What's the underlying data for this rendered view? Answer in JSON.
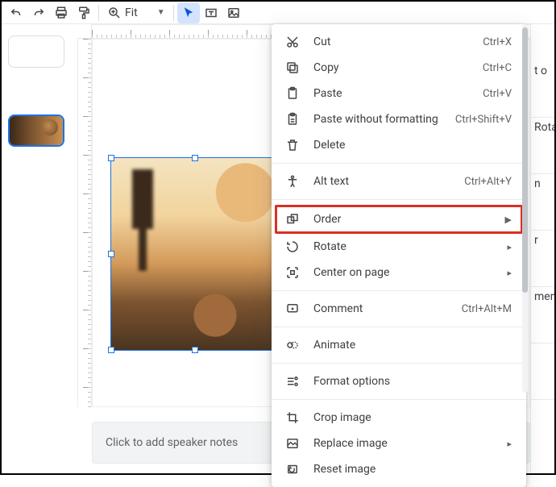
{
  "toolbar": {
    "zoom_label": "Fit"
  },
  "notes": {
    "placeholder": "Click to add speaker notes"
  },
  "side": {
    "f1": "t o",
    "f2": "Rota",
    "f3": "n",
    "f4": "r",
    "f5": "men"
  },
  "menu": {
    "cut": {
      "label": "Cut",
      "shortcut": "Ctrl+X"
    },
    "copy": {
      "label": "Copy",
      "shortcut": "Ctrl+C"
    },
    "paste": {
      "label": "Paste",
      "shortcut": "Ctrl+V"
    },
    "paste_wf": {
      "label": "Paste without formatting",
      "shortcut": "Ctrl+Shift+V"
    },
    "delete": {
      "label": "Delete"
    },
    "alt_text": {
      "label": "Alt text",
      "shortcut": "Ctrl+Alt+Y"
    },
    "order": {
      "label": "Order"
    },
    "rotate": {
      "label": "Rotate"
    },
    "center": {
      "label": "Center on page"
    },
    "comment": {
      "label": "Comment",
      "shortcut": "Ctrl+Alt+M"
    },
    "animate": {
      "label": "Animate"
    },
    "format": {
      "label": "Format options"
    },
    "crop": {
      "label": "Crop image"
    },
    "replace": {
      "label": "Replace image"
    },
    "reset": {
      "label": "Reset image"
    }
  }
}
